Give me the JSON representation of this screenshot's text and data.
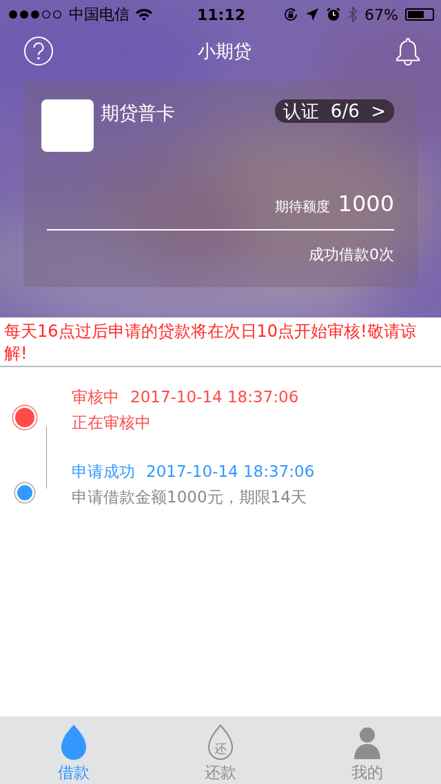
{
  "status_bar": {
    "carrier": "中国电信",
    "time": "11:12",
    "battery_text": "67%",
    "battery": {
      "level": 0.67
    }
  },
  "nav": {
    "title": "小期贷"
  },
  "card": {
    "name": "期贷普卡",
    "badge": "认证  6/6  >",
    "limit_label": "期待额度",
    "limit_value": "1000",
    "loans": "成功借款0次"
  },
  "notice": "每天16点过后申请的贷款将在次日10点开始审核!敬请谅解!",
  "timeline": [
    {
      "title": "审核中",
      "time": "2017-10-14 18:37:06",
      "text": "正在审核中",
      "color": "#ff4b4b",
      "current": true
    },
    {
      "title": "申请成功",
      "time": "2017-10-14 18:37:06",
      "text": "申请借款金额1000元，期限14天",
      "color": "#3399ff",
      "current": false
    }
  ],
  "tabs": [
    {
      "label": "借款",
      "kind": "drop",
      "selected": true
    },
    {
      "label": "还款",
      "kind": "drop-char",
      "icon_char": "还",
      "selected": false
    },
    {
      "label": "我的",
      "kind": "person",
      "selected": false
    }
  ]
}
